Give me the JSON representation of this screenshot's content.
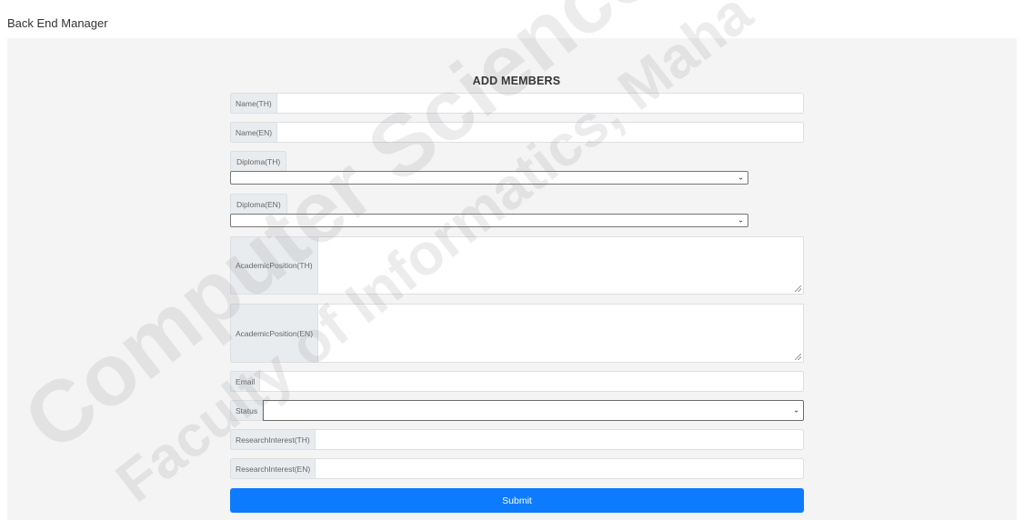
{
  "header": {
    "brand": "Back End Manager"
  },
  "form": {
    "title": "ADD MEMBERS",
    "name_th_label": "Name(TH)",
    "name_th_value": "",
    "name_en_label": "Name(EN)",
    "name_en_value": "",
    "diploma_th_label": "Diploma(TH)",
    "diploma_th_selected": "",
    "diploma_en_label": "Diploma(EN)",
    "diploma_en_selected": "",
    "academic_th_label": "AcademicPosition(TH)",
    "academic_th_value": "",
    "academic_en_label": "AcademicPosition(EN)",
    "academic_en_value": "",
    "email_label": "Email",
    "email_value": "",
    "status_label": "Status",
    "status_selected": "",
    "research_th_label": "ResearchInterest(TH)",
    "research_th_value": "",
    "research_en_label": "ResearchInterest(EN)",
    "research_en_value": "",
    "submit_label": "Submit"
  },
  "watermark": {
    "line1": "Computer Science",
    "line2": "Faculty of Informatics, Maha"
  }
}
